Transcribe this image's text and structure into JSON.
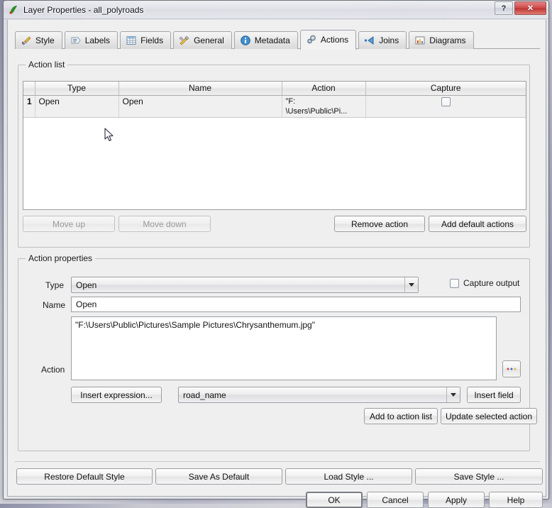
{
  "window": {
    "title": "Layer Properties - all_polyroads",
    "icon": "qgis-logo-icon",
    "help_button": "?",
    "close_button": "✕"
  },
  "tabs": [
    {
      "label": "Style",
      "icon": "paintbrush-icon",
      "active": false
    },
    {
      "label": "Labels",
      "icon": "label-tag-icon",
      "active": false
    },
    {
      "label": "Fields",
      "icon": "table-grid-icon",
      "active": false
    },
    {
      "label": "General",
      "icon": "tools-icon",
      "active": false
    },
    {
      "label": "Metadata",
      "icon": "info-circle-icon",
      "active": false
    },
    {
      "label": "Actions",
      "icon": "gears-icon",
      "active": true
    },
    {
      "label": "Joins",
      "icon": "join-arrow-icon",
      "active": false
    },
    {
      "label": "Diagrams",
      "icon": "bar-chart-icon",
      "active": false
    }
  ],
  "action_list": {
    "title": "Action list",
    "columns": [
      "",
      "Type",
      "Name",
      "Action",
      "Capture"
    ],
    "rows": [
      {
        "number": "1",
        "type": "Open",
        "name": "Open",
        "action": "\"F:\n\\Users\\Public\\Pi...",
        "capture_checked": false
      }
    ],
    "buttons": {
      "move_up": "Move up",
      "move_down": "Move down",
      "remove_action": "Remove action",
      "add_default_actions": "Add default actions"
    }
  },
  "action_properties": {
    "title": "Action properties",
    "type_label": "Type",
    "type_value": "Open",
    "capture_output_label": "Capture output",
    "capture_output_checked": false,
    "name_label": "Name",
    "name_value": "Open",
    "action_label": "Action",
    "action_value": "\"F:\\Users\\Public\\Pictures\\Sample Pictures\\Chrysanthemum.jpg\"",
    "browse_button": "...",
    "insert_expression_button": "Insert expression...",
    "field_value": "road_name",
    "insert_field_button": "Insert field",
    "add_to_action_list_button": "Add to action list",
    "update_selected_action_button": "Update selected action"
  },
  "footer": {
    "style_buttons": [
      "Restore Default Style",
      "Save As Default",
      "Load Style ...",
      "Save Style ..."
    ],
    "dialog_buttons": [
      {
        "label": "OK",
        "default": true
      },
      {
        "label": "Cancel",
        "default": false
      },
      {
        "label": "Apply",
        "default": false
      },
      {
        "label": "Help",
        "default": false
      }
    ]
  }
}
